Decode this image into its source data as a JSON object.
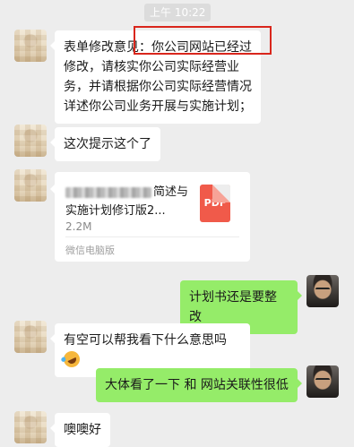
{
  "time_label": "上午 10:22",
  "messages": [
    {
      "text": "表单修改意见：你公司网站已经过修改，请核实你公司实际经营业务，并请根据你公司实际经营情况详述你公司业务开展与实施计划；"
    },
    {
      "text": "这次提示这个了"
    },
    {
      "file": {
        "name_visible": "简述与实施计划修订版2...",
        "size": "2.2M",
        "source": "微信电脑版",
        "type_label": "PDF"
      }
    },
    {
      "text": "计划书还是要整改"
    },
    {
      "text": "有空可以帮我看下什么意思吗"
    },
    {
      "text": "大体看了一下 和 网站关联性很低"
    },
    {
      "text": "噢噢好"
    }
  ],
  "colors": {
    "background": "#ededed",
    "incoming_bubble": "#ffffff",
    "outgoing_bubble": "#95ec69",
    "highlight_box": "#d9261c",
    "pdf_icon": "#f05a4a"
  },
  "icons": [
    "pdf-file-icon",
    "laugh-cry-emoji",
    "contact-avatar",
    "my-avatar"
  ]
}
